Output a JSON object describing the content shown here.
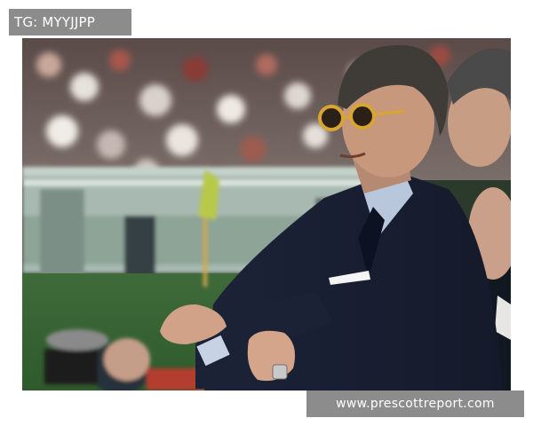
{
  "watermark": {
    "text": "TG: MYYJJPP"
  },
  "footer": {
    "url": "www.prescottreport.com"
  },
  "colors": {
    "label_background": "#8c8c8c",
    "label_text": "#ffffff",
    "page_background": "#ffffff"
  }
}
